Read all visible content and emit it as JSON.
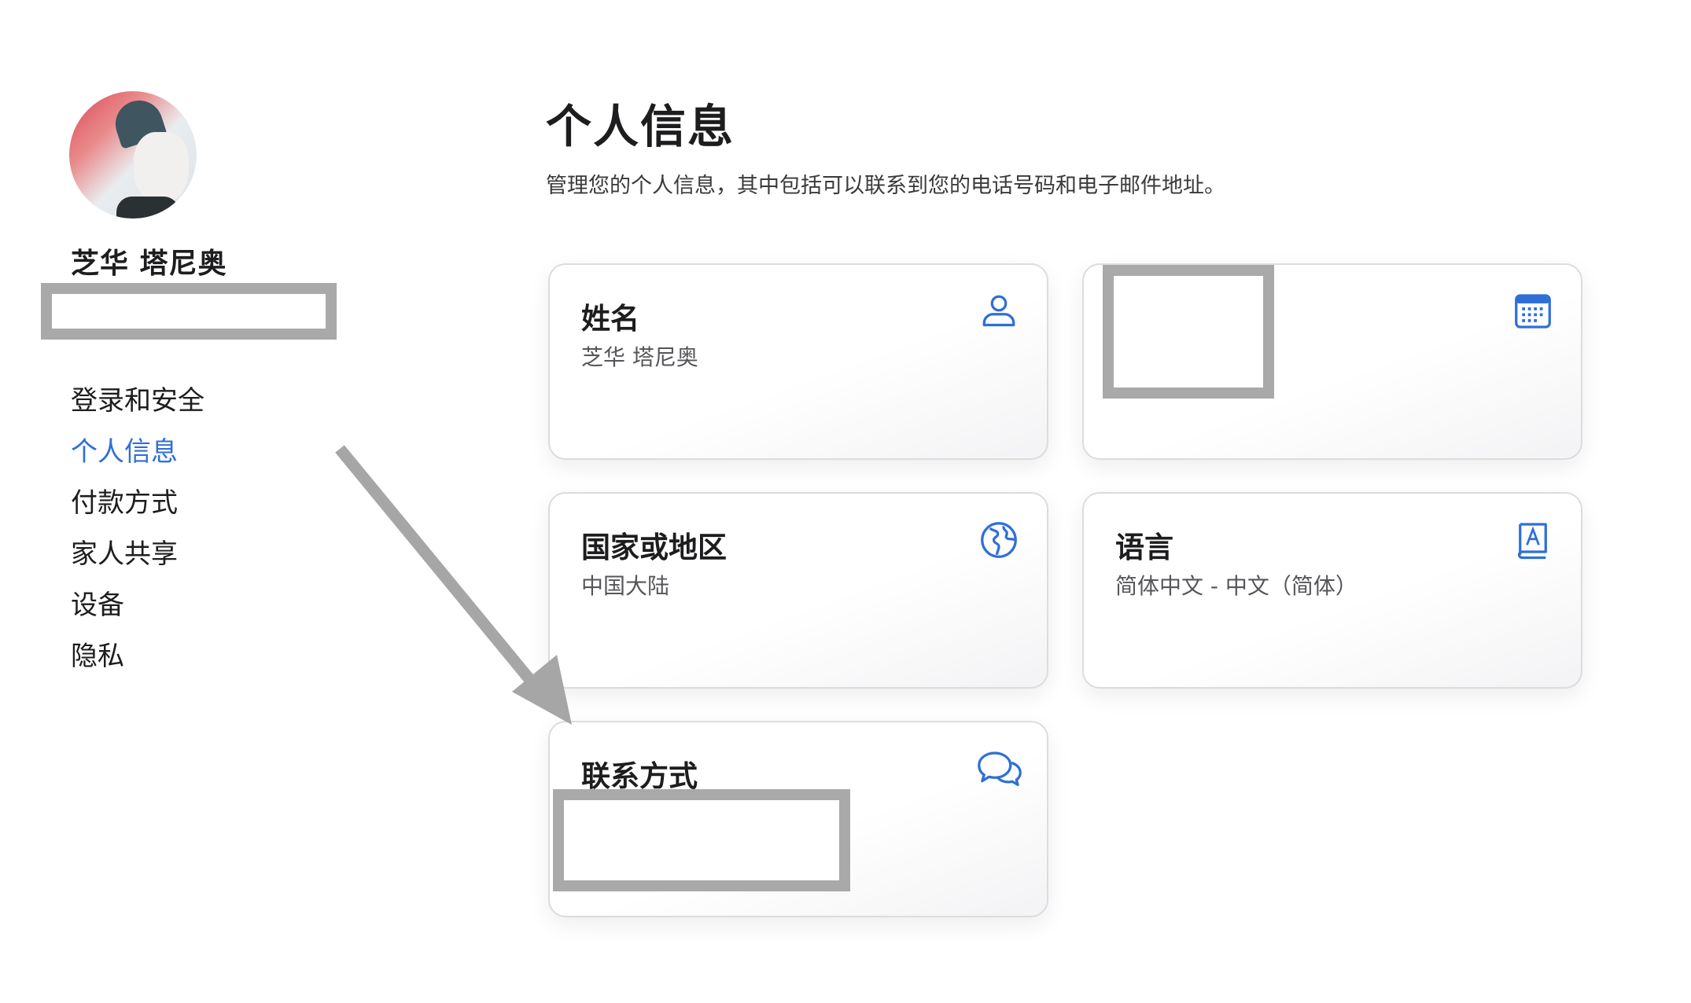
{
  "user": {
    "name": "芝华 塔尼奥"
  },
  "sidebar": {
    "items": [
      {
        "label": "登录和安全",
        "active": false
      },
      {
        "label": "个人信息",
        "active": true
      },
      {
        "label": "付款方式",
        "active": false
      },
      {
        "label": "家人共享",
        "active": false
      },
      {
        "label": "设备",
        "active": false
      },
      {
        "label": "隐私",
        "active": false
      }
    ]
  },
  "main": {
    "title": "个人信息",
    "description": "管理您的个人信息，其中包括可以联系到您的电话号码和电子邮件地址。",
    "cards": {
      "name": {
        "title": "姓名",
        "value": "芝华 塔尼奥",
        "icon": "person-icon"
      },
      "birthday": {
        "icon": "calendar-icon"
      },
      "country": {
        "title": "国家或地区",
        "value": "中国大陆",
        "icon": "globe-icon"
      },
      "language": {
        "title": "语言",
        "value": "简体中文 - 中文（简体）",
        "icon": "dictionary-icon"
      },
      "contact": {
        "title": "联系方式",
        "icon": "chat-bubbles-icon"
      }
    }
  },
  "colors": {
    "accent": "#2f6fd6",
    "redaction": "#a9a9a9",
    "arrow": "#a6a6a6"
  }
}
